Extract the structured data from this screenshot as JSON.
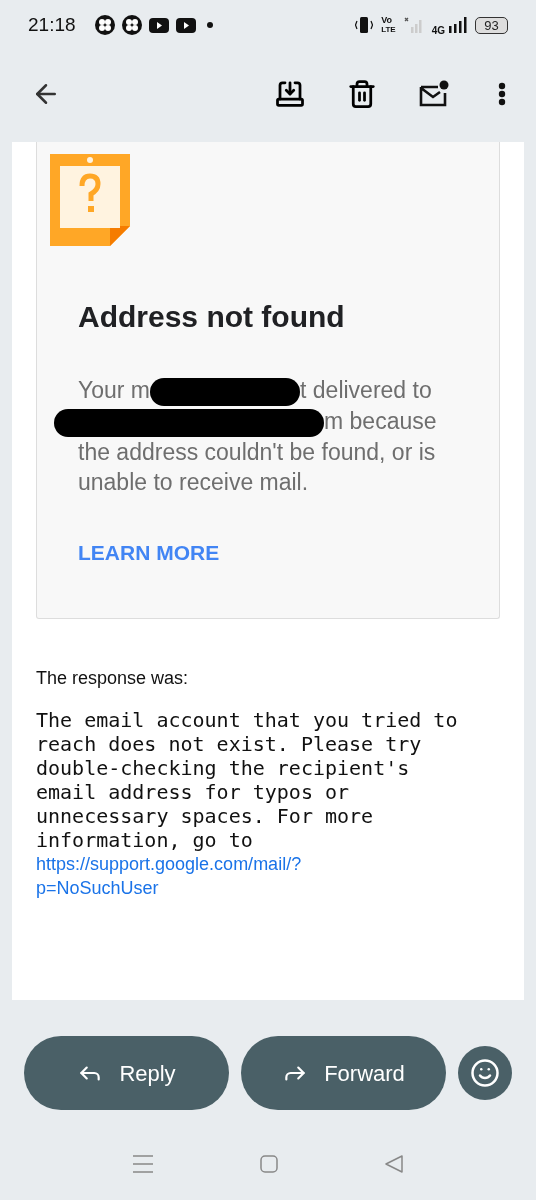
{
  "status_bar": {
    "time": "21:18",
    "volte_top": "Vo",
    "volte_bottom": "LTE",
    "network": "4G",
    "battery": "93"
  },
  "bounce_card": {
    "title": "Address not found",
    "message_parts": [
      {
        "kind": "text",
        "text": "Your m"
      },
      {
        "kind": "redaction"
      },
      {
        "kind": "text",
        "text": "t delivered to"
      },
      {
        "kind": "redaction"
      },
      {
        "kind": "text",
        "text": "m because"
      },
      {
        "kind": "text_block",
        "text": "the address couldn't be found, or is unable to receive mail."
      }
    ],
    "link": "LEARN MORE"
  },
  "response": {
    "label": "The response was:",
    "body": "The email account that you tried to reach does not exist. Please try double-checking the recipient's email address for typos or unnecessary spaces. For more information, go to",
    "link": "https://support.google.com/mail/?p=NoSuchUser"
  },
  "actions": [
    {
      "kind": "reply",
      "label": "Reply"
    },
    {
      "kind": "forward",
      "label": "Forward"
    },
    {
      "kind": "emoji"
    }
  ]
}
